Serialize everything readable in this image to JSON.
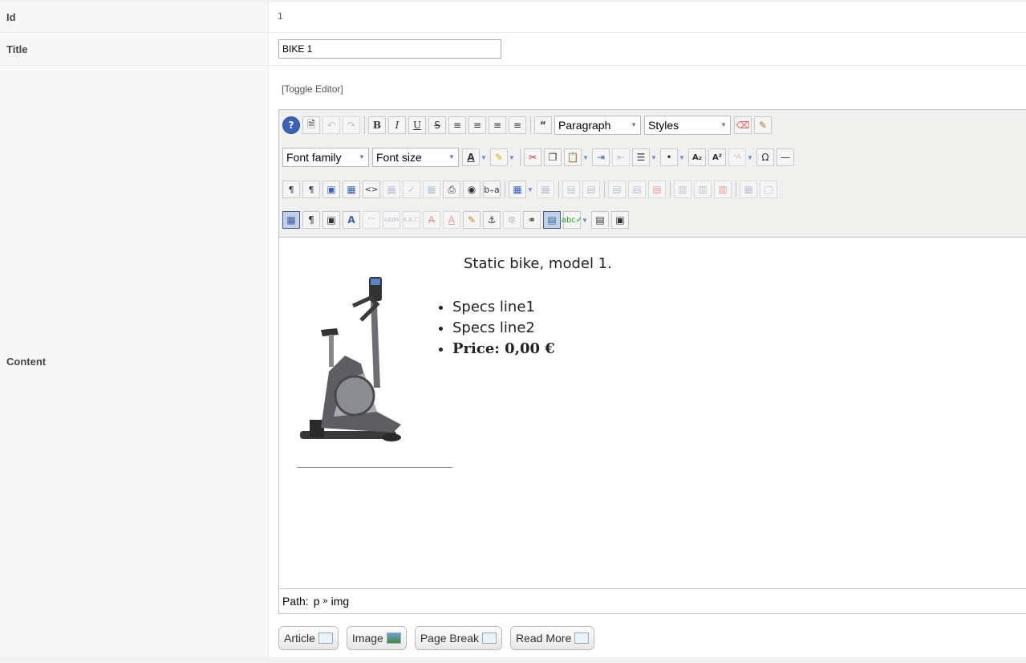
{
  "fields": {
    "id_label": "Id",
    "id_value": "1",
    "title_label": "Title",
    "title_value": "BIKE 1",
    "content_label": "Content"
  },
  "editor": {
    "toggle_label": "[Toggle Editor]",
    "format_select": "Paragraph",
    "styles_select": "Styles",
    "font_family_select": "Font family",
    "font_size_select": "Font size",
    "toolbar_icons": {
      "row1": [
        "help-icon",
        "new-document-icon",
        "undo-icon",
        "redo-icon",
        "bold-icon",
        "italic-icon",
        "underline-icon",
        "strikethrough-icon",
        "align-justify-icon",
        "align-center-icon",
        "align-left-icon",
        "align-right-icon",
        "blockquote-icon",
        "remove-format-icon",
        "cleanup-icon"
      ],
      "row2": [
        "font-color-icon",
        "highlight-color-icon",
        "cut-icon",
        "copy-icon",
        "paste-icon",
        "indent-icon",
        "outdent-icon",
        "numbered-list-icon",
        "bullet-list-icon",
        "subscript-icon",
        "superscript-icon",
        "char-map-icon",
        "horizontal-rule-icon"
      ],
      "row3": [
        "ltr-icon",
        "rtl-icon",
        "fullscreen-icon",
        "template-icon",
        "code-icon",
        "print-icon",
        "find-icon",
        "replace-icon",
        "table-icon",
        "table-row-icon",
        "table-column-icon",
        "table-cell-icon"
      ],
      "row4": [
        "visual-aid-icon",
        "show-blocks-icon",
        "style-props-icon",
        "abbreviation-icon",
        "citation-icon",
        "anchor-icon",
        "link-icon",
        "image-icon",
        "spellcheck-icon",
        "layer-icon"
      ]
    },
    "content": {
      "heading": "Static bike, model 1.",
      "specs": [
        "Specs line1",
        "Specs line2",
        "Price: 0,00 €"
      ]
    },
    "path_label": "Path:",
    "path_items": [
      "p",
      "img"
    ],
    "path_separator": "»"
  },
  "buttons": {
    "article": "Article",
    "image": "Image",
    "page_break": "Page Break",
    "read_more": "Read More"
  }
}
